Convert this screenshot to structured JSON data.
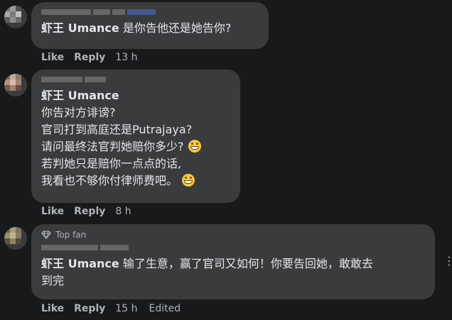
{
  "comments": [
    {
      "mention": "虾王 Umance",
      "lines": [
        "是你告他还是她告你?"
      ],
      "actions": {
        "like": "Like",
        "reply": "Reply",
        "time": "13 h"
      }
    },
    {
      "mention": "虾王 Umance",
      "lines": [
        "你告对方诽谤?",
        "官司打到高庭还是Putrajaya?",
        "请问最终法官判她赔你多少?",
        "若判她只是赔你一点点的话,",
        "我看也不够你付律师费吧。"
      ],
      "emojis": {
        "line3": "grinning-face-emoji",
        "line5": "grinning-face-emoji"
      },
      "actions": {
        "like": "Like",
        "reply": "Reply",
        "time": "8 h"
      }
    },
    {
      "badge": "Top fan",
      "mention": "虾王 Umance",
      "lines": [
        "输了生意，赢了官司又如何！你要告回她，敢敢去",
        "到完"
      ],
      "actions": {
        "like": "Like",
        "reply": "Reply",
        "time": "15 h",
        "edited": "Edited"
      }
    }
  ],
  "icons": {
    "badge": "diamond-icon",
    "more": "more-options-icon"
  },
  "colors": {
    "background": "#18191a",
    "bubble": "#3a3b3c",
    "text": "#e4e6eb",
    "muted": "#b0b3b8"
  }
}
